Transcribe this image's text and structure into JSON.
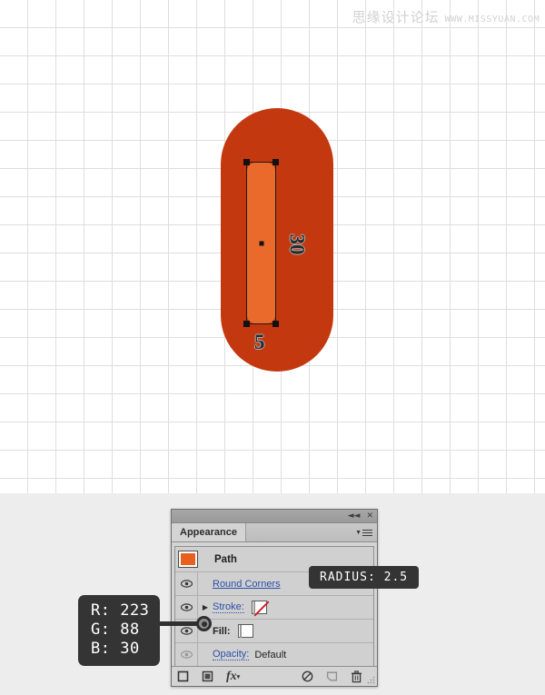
{
  "watermark": {
    "cn": "思缘设计论坛",
    "en": "WWW.MISSYUAN.COM"
  },
  "canvas": {
    "shape_name": "rounded-capsule",
    "outer_color": "#c43810",
    "inner_color": "#ea6a2c",
    "measurements": {
      "height": "30",
      "width": "5"
    }
  },
  "panel": {
    "title": "Appearance",
    "titlebar": {
      "collapse": "◄◄",
      "close": "✕"
    },
    "rows": [
      {
        "label": "Path",
        "type": "header"
      },
      {
        "label": "Round Corners",
        "type": "effect"
      },
      {
        "label": "Stroke:",
        "type": "stroke",
        "swatch": "none"
      },
      {
        "label": "Fill:",
        "type": "fill",
        "swatch": "#e8601f"
      },
      {
        "label": "Opacity:",
        "value": "Default",
        "type": "opacity"
      }
    ],
    "footer": {
      "add_new_stroke": "add-new-stroke",
      "add_new_fill": "add-new-fill",
      "add_effect": "fx",
      "clear_appearance": "clear-appearance",
      "duplicate_item": "duplicate-selected-item",
      "delete_item": "delete-selected-item"
    }
  },
  "callouts": {
    "rgb": {
      "r": "R: 223",
      "g": "G: 88",
      "b": "B: 30",
      "hex": "#df581e"
    },
    "radius": "RADIUS: 2.5"
  }
}
